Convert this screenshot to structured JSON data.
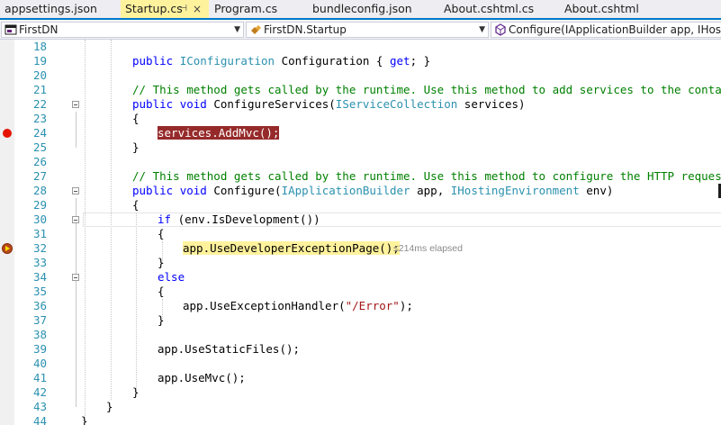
{
  "tabs": [
    {
      "label": "appsettings.json",
      "active": false
    },
    {
      "label": "Startup.cs",
      "active": true,
      "pin": "⊣",
      "close": "×"
    },
    {
      "label": "Program.cs",
      "active": false
    },
    {
      "label": "bundleconfig.json",
      "active": false
    },
    {
      "label": "About.cshtml.cs",
      "active": false
    },
    {
      "label": "About.cshtml",
      "active": false
    }
  ],
  "navbar": {
    "project": "FirstDN",
    "type": "FirstDN.Startup",
    "member": "Configure(IApplicationBuilder app, IHostingEnvironment env)"
  },
  "code": {
    "lines": [
      {
        "n": "18"
      },
      {
        "n": "19"
      },
      {
        "n": "20"
      },
      {
        "n": "21"
      },
      {
        "n": "22"
      },
      {
        "n": "23"
      },
      {
        "n": "24"
      },
      {
        "n": "25"
      },
      {
        "n": "26"
      },
      {
        "n": "27"
      },
      {
        "n": "28"
      },
      {
        "n": "29"
      },
      {
        "n": "30"
      },
      {
        "n": "31"
      },
      {
        "n": "32"
      },
      {
        "n": "33"
      },
      {
        "n": "34"
      },
      {
        "n": "35"
      },
      {
        "n": "36"
      },
      {
        "n": "37"
      },
      {
        "n": "38"
      },
      {
        "n": "39"
      },
      {
        "n": "40"
      },
      {
        "n": "41"
      },
      {
        "n": "42"
      },
      {
        "n": "43"
      },
      {
        "n": "44"
      }
    ],
    "l19": {
      "kw": "public",
      "ty": "IConfiguration",
      "rest": " Configuration { ",
      "kw2": "get",
      "end": "; }"
    },
    "l21": "// This method gets called by the runtime. Use this method to add services to the container.",
    "l22": {
      "kw1": "public",
      "kw2": "void",
      "name": " ConfigureServices(",
      "ty": "IServiceCollection",
      "rest": " services)"
    },
    "l24": "services.AddMvc();",
    "l27": "// This method gets called by the runtime. Use this method to configure the HTTP request pipe",
    "l28": {
      "kw1": "public",
      "kw2": "void",
      "name": " Configure(",
      "ty1": "IApplicationBuilder",
      "mid": " app, ",
      "ty2": "IHostingEnvironment",
      "rest": " env)"
    },
    "l30": {
      "kw": "if",
      "rest": " (env.IsDevelopment())"
    },
    "l32": "app.UseDeveloperExceptionPage();",
    "elapsed": "≤214ms elapsed",
    "l34": "else",
    "l36": {
      "pre": "app.UseExceptionHandler(",
      "str": "\"/Error\"",
      "post": ");"
    },
    "l39": "app.UseStaticFiles();",
    "l41": "app.UseMvc();",
    "brace_open": "{",
    "brace_close": "}"
  },
  "colors": {
    "keyword": "#0000ff",
    "type": "#2b91af",
    "comment": "#008000",
    "string": "#a31515",
    "breakpoint": "#e51400",
    "breakpoint_highlight": "#962a2a",
    "current_statement": "#fff29d",
    "accent": "#007acc"
  }
}
